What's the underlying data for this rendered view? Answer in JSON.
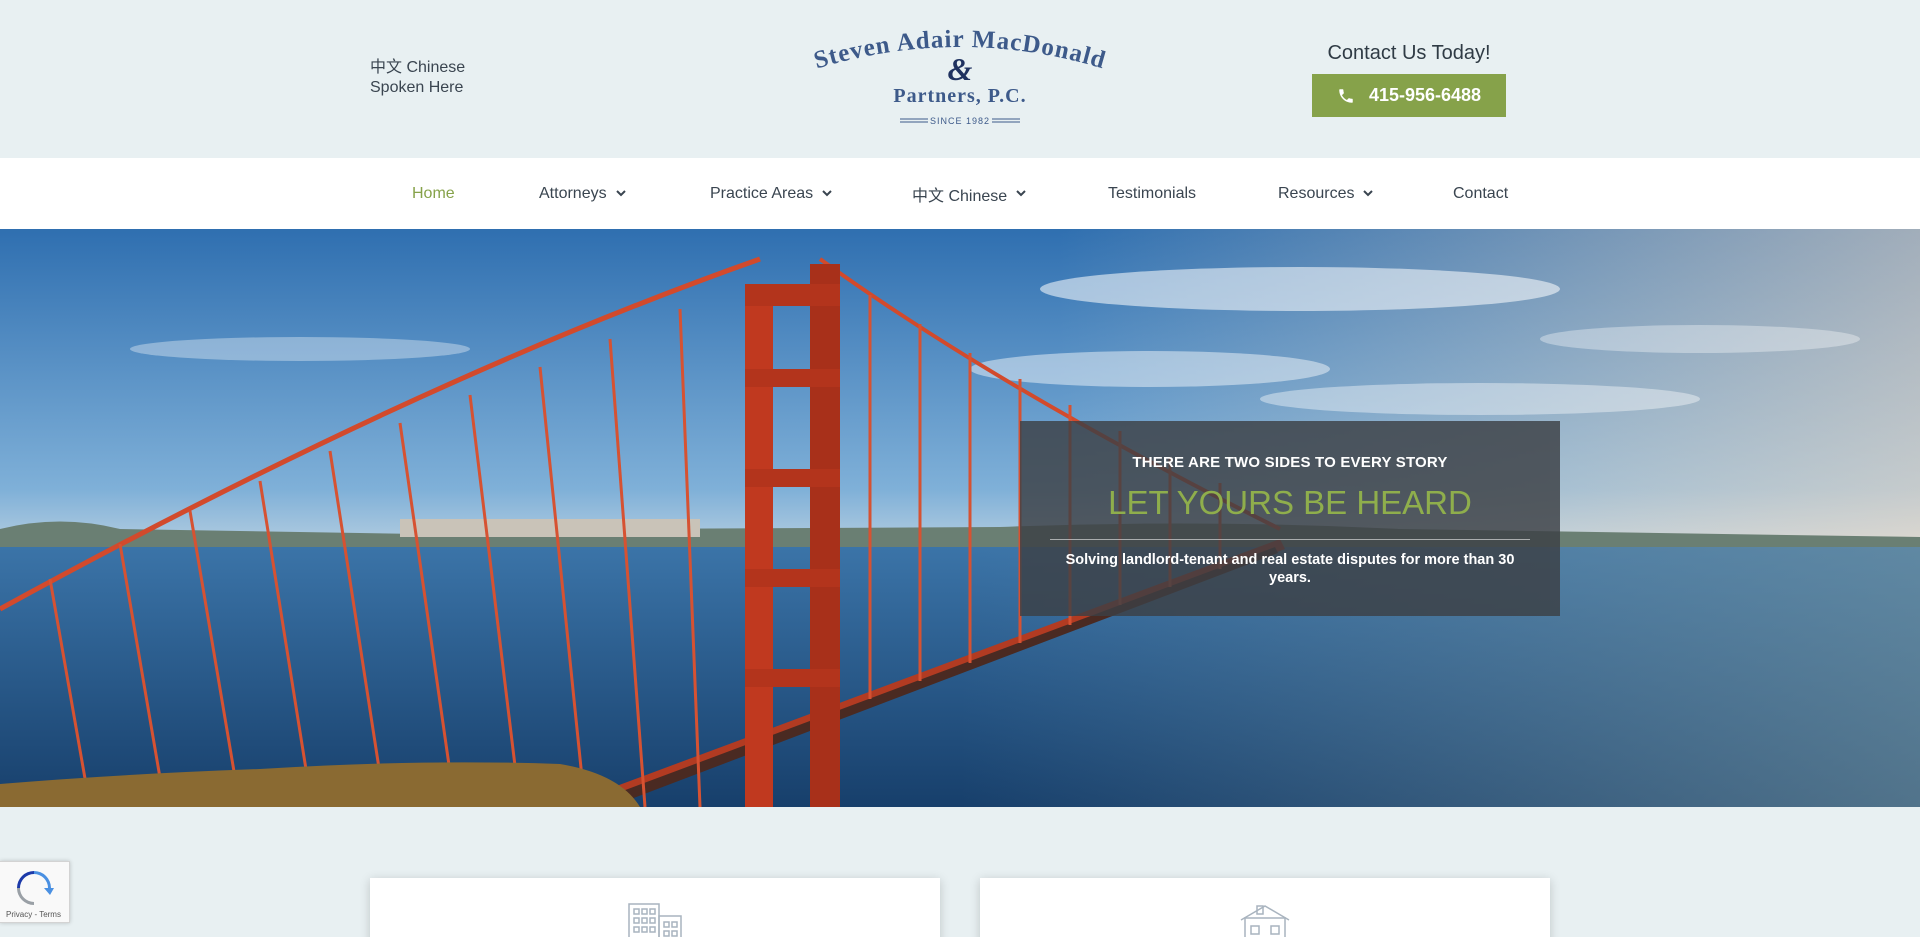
{
  "header": {
    "language_note_line1": "中文 Chinese",
    "language_note_line2": "Spoken Here",
    "logo": {
      "line1": "Steven Adair MacDonald",
      "ampersand": "&",
      "line2": "Partners, P.C.",
      "since": "SINCE 1982"
    },
    "contact_title": "Contact Us Today!",
    "phone": "415-956-6488",
    "phone_icon": "phone-icon"
  },
  "nav": {
    "items": [
      {
        "label": "Home",
        "active": true,
        "has_dropdown": false
      },
      {
        "label": "Attorneys",
        "active": false,
        "has_dropdown": true
      },
      {
        "label": "Practice Areas",
        "active": false,
        "has_dropdown": true
      },
      {
        "label": "中文 Chinese",
        "active": false,
        "has_dropdown": true
      },
      {
        "label": "Testimonials",
        "active": false,
        "has_dropdown": false
      },
      {
        "label": "Resources",
        "active": false,
        "has_dropdown": true
      },
      {
        "label": "Contact",
        "active": false,
        "has_dropdown": false
      }
    ]
  },
  "hero": {
    "kicker": "THERE ARE TWO SIDES TO EVERY STORY",
    "headline": "LET YOURS BE HEARD",
    "subtext": "Solving landlord-tenant and real estate disputes for more than 30 years."
  },
  "features": [
    {
      "icon": "buildings-icon"
    },
    {
      "icon": "house-icon"
    }
  ],
  "recaptcha": {
    "links": "Privacy - Terms"
  },
  "colors": {
    "accent": "#86a24a",
    "background": "#e8f0f2",
    "logo_blue": "#3d5a8a"
  }
}
